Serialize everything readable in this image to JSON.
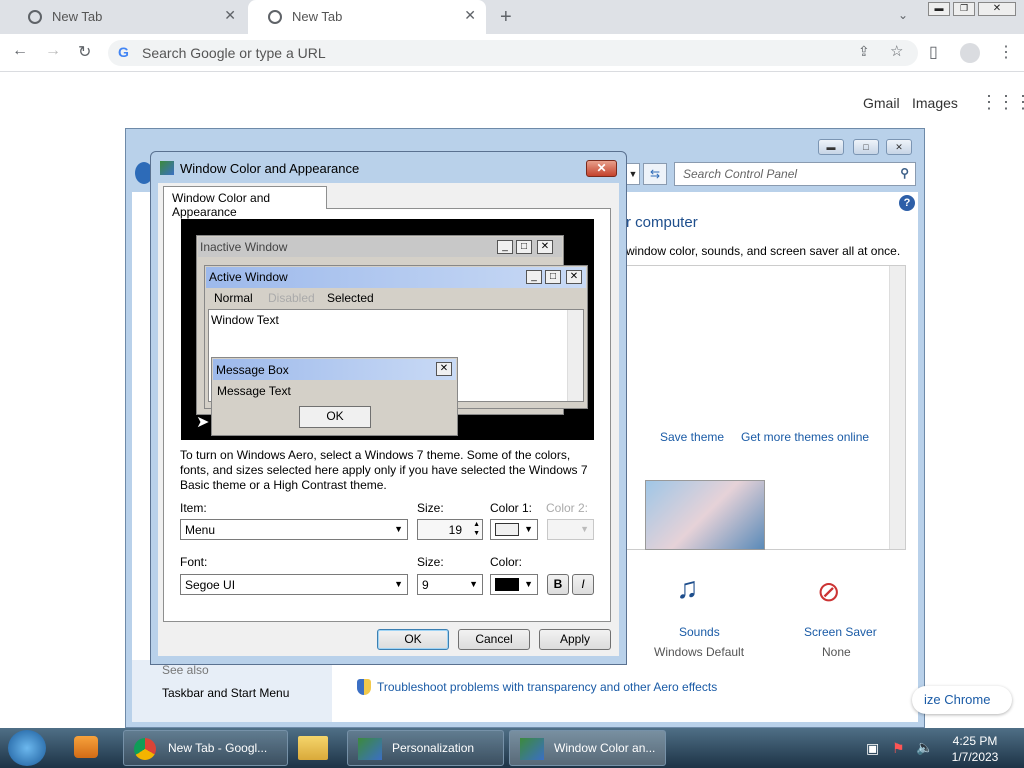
{
  "browser": {
    "tabs": [
      {
        "label": "New Tab"
      },
      {
        "label": "New Tab"
      }
    ],
    "new_tab_symbol": "+",
    "omnibox_placeholder": "Search Google or type a URL",
    "top_links": {
      "gmail": "Gmail",
      "images": "Images"
    },
    "customize_label": "ize Chrome"
  },
  "control_panel": {
    "search_placeholder": "Search Control Panel",
    "heading": "r computer",
    "description": "window color, sounds, and screen saver all at once.",
    "save_theme": "Save theme",
    "get_more_themes": "Get more themes online",
    "sounds_label": "Sounds",
    "sounds_value": "Windows Default",
    "screensaver_label": "Screen Saver",
    "screensaver_value": "None",
    "see_also": "See also",
    "taskbar_link": "Taskbar and Start Menu",
    "troubleshoot": "Troubleshoot problems with transparency and other Aero effects"
  },
  "dialog": {
    "title": "Window Color and Appearance",
    "tab_label": "Window Color and Appearance",
    "preview": {
      "inactive_title": "Inactive Window",
      "active_title": "Active Window",
      "menu_normal": "Normal",
      "menu_disabled": "Disabled",
      "menu_selected": "Selected",
      "window_text": "Window Text",
      "msgbox_title": "Message Box",
      "msgbox_text": "Message Text",
      "msgbox_ok": "OK"
    },
    "info": "To turn on Windows Aero, select a Windows 7 theme.  Some of the colors, fonts, and sizes selected here apply only if you have selected the Windows 7 Basic theme or a High Contrast theme.",
    "item_label": "Item:",
    "item_value": "Menu",
    "size_label": "Size:",
    "size_value": "19",
    "color1_label": "Color 1:",
    "color2_label": "Color 2:",
    "font_label": "Font:",
    "font_value": "Segoe UI",
    "font_size_label": "Size:",
    "font_size_value": "9",
    "font_color_label": "Color:",
    "bold_label": "B",
    "italic_label": "I",
    "ok": "OK",
    "cancel": "Cancel",
    "apply": "Apply"
  },
  "taskbar": {
    "chrome_item": "New Tab - Googl...",
    "personalization_item": "Personalization",
    "wca_item": "Window Color an...",
    "time": "4:25 PM",
    "date": "1/7/2023"
  },
  "colors": {
    "accent": "#1a5ba6",
    "dialog_frame": "#b9d1ea",
    "title_bar_active": "#9db9eb"
  }
}
